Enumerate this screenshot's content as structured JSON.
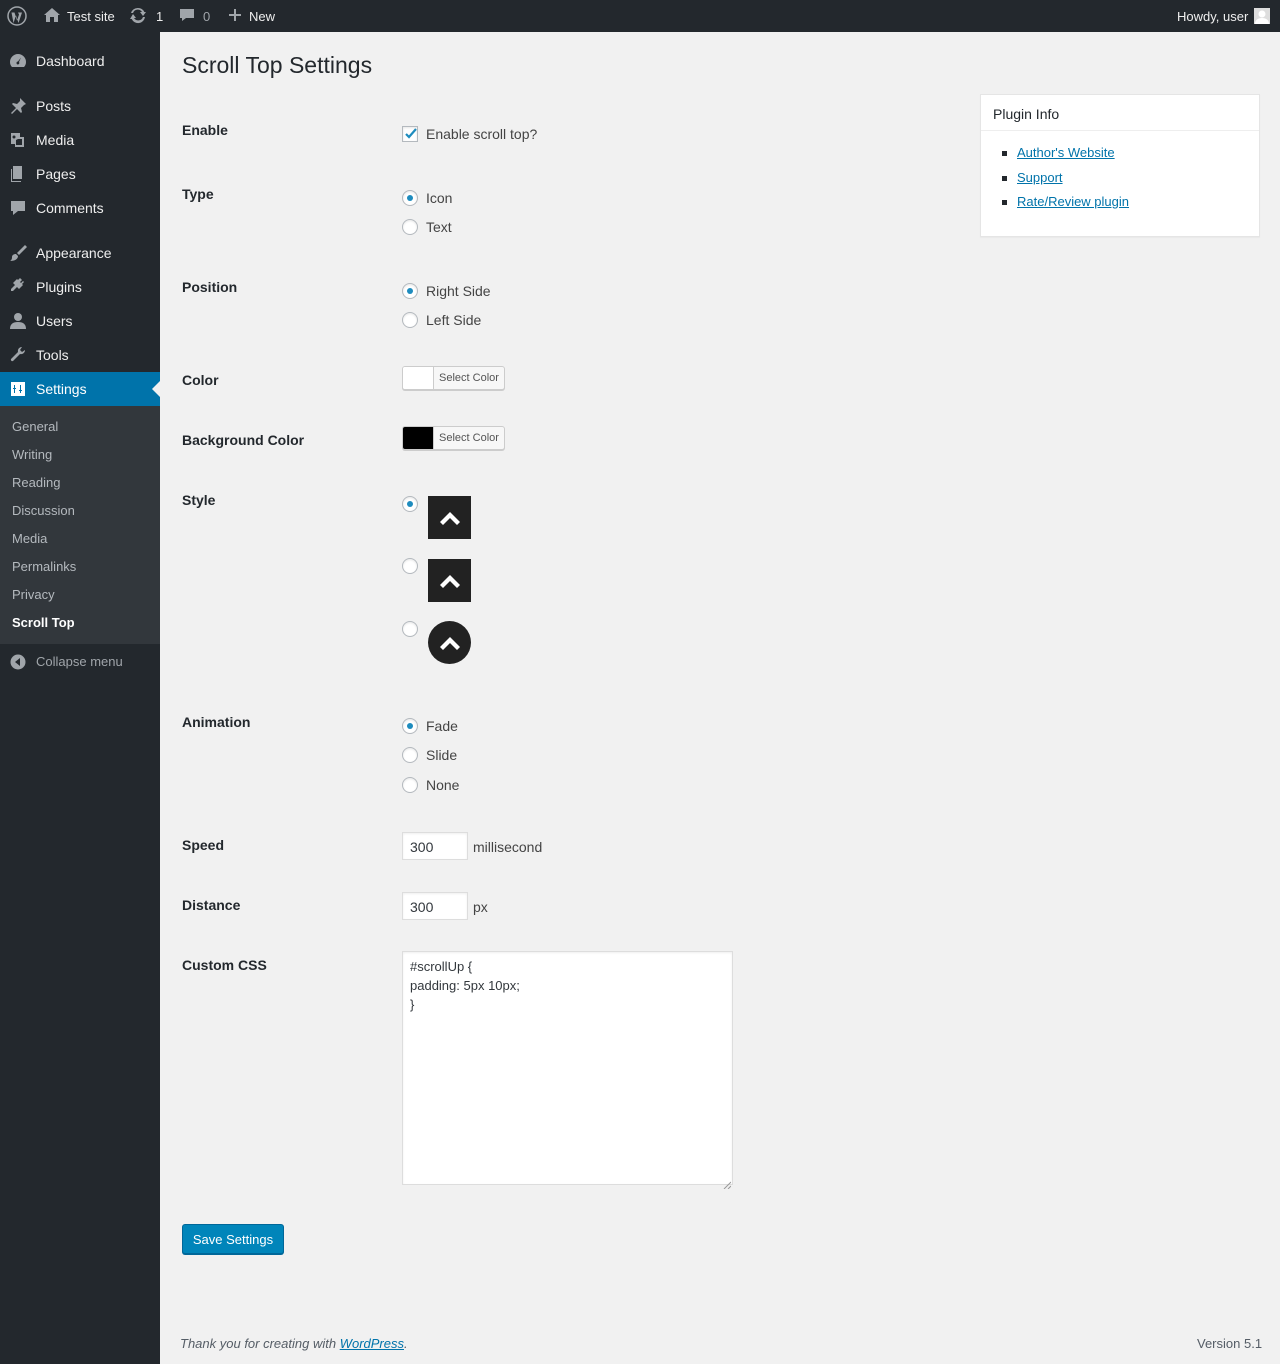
{
  "adminbar": {
    "site_name": "Test site",
    "updates_count": "1",
    "comments_count": "0",
    "new_label": "New",
    "howdy": "Howdy, user"
  },
  "sidebar": {
    "items": [
      {
        "label": "Dashboard",
        "icon": "dashboard-icon"
      },
      {
        "label": "Posts",
        "icon": "pin-icon"
      },
      {
        "label": "Media",
        "icon": "media-icon"
      },
      {
        "label": "Pages",
        "icon": "page-icon"
      },
      {
        "label": "Comments",
        "icon": "comment-icon"
      },
      {
        "label": "Appearance",
        "icon": "brush-icon"
      },
      {
        "label": "Plugins",
        "icon": "plug-icon"
      },
      {
        "label": "Users",
        "icon": "user-icon"
      },
      {
        "label": "Tools",
        "icon": "wrench-icon"
      },
      {
        "label": "Settings",
        "icon": "settings-icon"
      }
    ],
    "submenu": [
      "General",
      "Writing",
      "Reading",
      "Discussion",
      "Media",
      "Permalinks",
      "Privacy",
      "Scroll Top"
    ],
    "collapse_label": "Collapse menu"
  },
  "main": {
    "title": "Scroll Top Settings",
    "enable": {
      "label": "Enable",
      "option": "Enable scroll top?",
      "checked": true
    },
    "type": {
      "label": "Type",
      "options": [
        "Icon",
        "Text"
      ],
      "selected": "Icon"
    },
    "position": {
      "label": "Position",
      "options": [
        "Right Side",
        "Left Side"
      ],
      "selected": "Right Side"
    },
    "color": {
      "label": "Color",
      "button": "Select Color",
      "value": "#ffffff"
    },
    "background_color": {
      "label": "Background Color",
      "button": "Select Color",
      "value": "#000000"
    },
    "style": {
      "label": "Style",
      "selected_index": 0,
      "icons": [
        "square-chevron-up-icon",
        "square-chevron-up-icon",
        "round-chevron-up-icon"
      ]
    },
    "animation": {
      "label": "Animation",
      "options": [
        "Fade",
        "Slide",
        "None"
      ],
      "selected": "Fade"
    },
    "speed": {
      "label": "Speed",
      "value": "300",
      "unit": "millisecond"
    },
    "distance": {
      "label": "Distance",
      "value": "300",
      "unit": "px"
    },
    "custom_css": {
      "label": "Custom CSS",
      "value": "#scrollUp {\npadding: 5px 10px;\n}"
    },
    "save_label": "Save Settings"
  },
  "plugin_info": {
    "title": "Plugin Info",
    "links": [
      "Author's Website",
      "Support",
      "Rate/Review plugin"
    ]
  },
  "footer": {
    "thanks_prefix": "Thank you for creating with ",
    "thanks_link": "WordPress",
    "thanks_suffix": ".",
    "version": "Version 5.1"
  },
  "colors": {
    "accent": "#0073aa",
    "sidebar": "#23282d",
    "submenu": "#32373c",
    "save_button": "#0085ba"
  }
}
